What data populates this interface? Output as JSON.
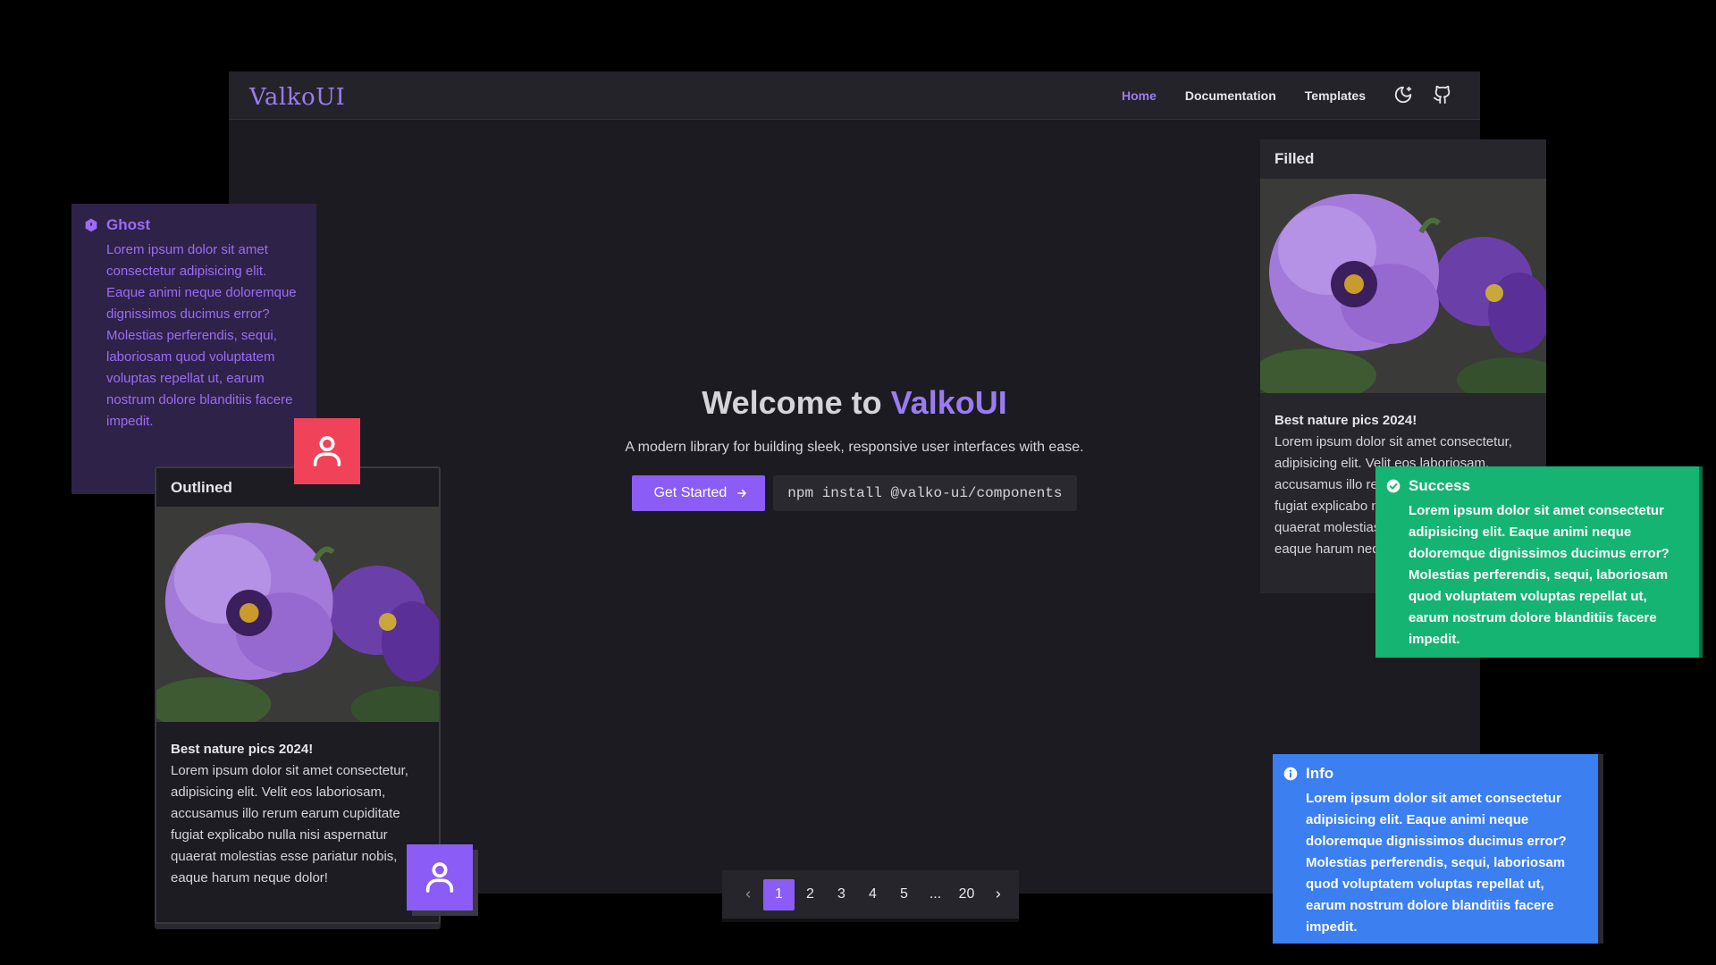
{
  "nav": {
    "logo": "ValkoUI",
    "links": [
      "Home",
      "Documentation",
      "Templates"
    ],
    "icons": [
      "moon-icon",
      "github-icon"
    ]
  },
  "hero": {
    "title_prefix": "Welcome to ",
    "title_brand": "ValkoUI",
    "subtitle": "A modern library for building sleek, responsive user interfaces with ease.",
    "cta_label": "Get Started",
    "install_command": "npm install @valko-ui/components"
  },
  "pagination": {
    "pages": [
      "1",
      "2",
      "3",
      "4",
      "5",
      "...",
      "20"
    ],
    "active_page": "1"
  },
  "ghost_alert": {
    "title": "Ghost",
    "body": "Lorem ipsum dolor sit amet consectetur adipisicing elit. Eaque animi neque doloremque dignissimos ducimus error? Molestias perferendis, sequi, laboriosam quod voluptatem voluptas repellat ut, earum nostrum dolore blanditiis facere impedit."
  },
  "outlined_card": {
    "header": "Outlined",
    "title": "Best nature pics 2024!",
    "text": "Lorem ipsum dolor sit amet consectetur, adipisicing elit. Velit eos laboriosam, accusamus illo rerum earum cupiditate fugiat explicabo nulla nisi aspernatur quaerat molestias esse pariatur nobis, eaque harum neque dolor!"
  },
  "filled_card": {
    "header": "Filled",
    "title": "Best nature pics 2024!",
    "text": "Lorem ipsum dolor sit amet consectetur, adipisicing elit. Velit eos laboriosam, accusamus illo rerum earum cupiditate fugiat explicabo nulla nisi aspernatur quaerat molestias esse pariatur nobis, eaque harum neque dolor!"
  },
  "success_alert": {
    "title": "Success",
    "body": "Lorem ipsum dolor sit amet consectetur adipisicing elit. Eaque animi neque doloremque dignissimos ducimus error? Molestias perferendis, sequi, laboriosam quod voluptatem voluptas repellat ut, earum nostrum dolore blanditiis facere impedit."
  },
  "info_alert": {
    "title": "Info",
    "body": "Lorem ipsum dolor sit amet consectetur adipisicing elit. Eaque animi neque doloremque dignissimos ducimus error? Molestias perferendis, sequi, laboriosam quod voluptatem voluptas repellat ut, earum nostrum dolore blanditiis facere impedit."
  },
  "colors": {
    "accent": "#8b5cf6",
    "background": "#1c1b21",
    "danger": "#f0435a",
    "success": "#15b472",
    "info": "#3b7ff0"
  }
}
